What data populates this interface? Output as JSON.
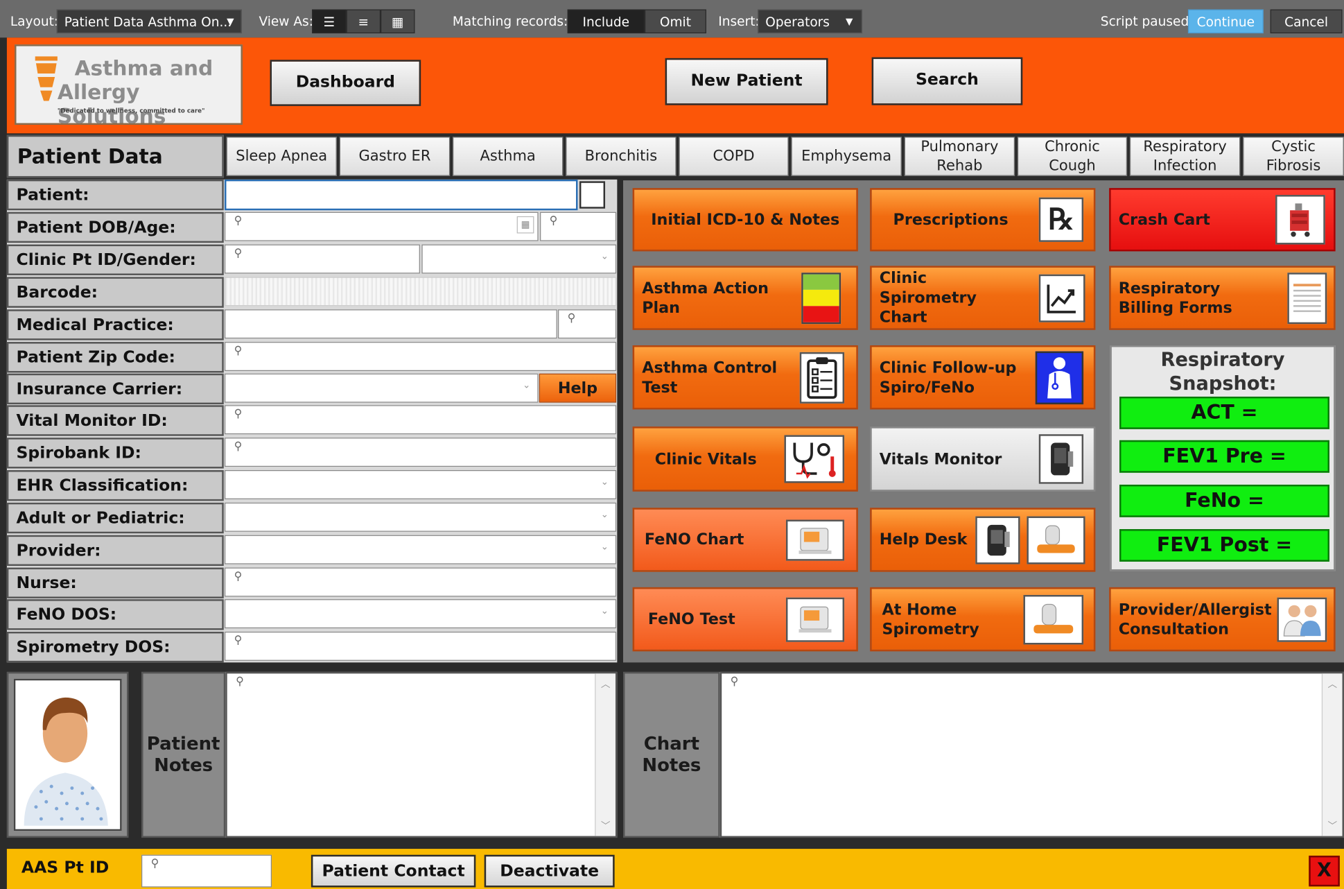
{
  "toolbar": {
    "layout_label": "Layout:",
    "layout_value": "Patient Data Asthma On...",
    "view_as_label": "View As:",
    "matching_label": "Matching records:",
    "include_label": "Include",
    "omit_label": "Omit",
    "insert_label": "Insert:",
    "insert_value": "Operators",
    "script_status": "Script paused",
    "continue_label": "Continue",
    "cancel_label": "Cancel"
  },
  "header": {
    "logo_line1": "Asthma and",
    "logo_line2": "Allergy Solutions",
    "logo_tagline": "\"Dedicated to wellness, committed to care\"",
    "dashboard_label": "Dashboard",
    "new_patient_label": "New Patient",
    "search_label": "Search"
  },
  "patient_data_title": "Patient Data",
  "tabs": [
    "Sleep Apnea",
    "Gastro ER",
    "Asthma",
    "Bronchitis",
    "COPD",
    "Emphysema",
    "Pulmonary Rehab",
    "Chronic Cough",
    "Respiratory Infection",
    "Cystic Fibrosis"
  ],
  "fields": {
    "patient": "Patient:",
    "dob": "Patient DOB/Age:",
    "clinic_id": "Clinic Pt ID/Gender:",
    "barcode": "Barcode:",
    "medical_practice": "Medical Practice:",
    "zip": "Patient Zip Code:",
    "insurance": "Insurance Carrier:",
    "vital_monitor": "Vital Monitor ID:",
    "spirobank": "Spirobank ID:",
    "ehr": "EHR Classification:",
    "adult_ped": "Adult or Pediatric:",
    "provider": "Provider:",
    "nurse": "Nurse:",
    "feno_dos": "FeNO DOS:",
    "spiro_dos": "Spirometry DOS:",
    "help_label": "Help"
  },
  "buttons": {
    "icd": "Initial ICD-10 & Notes",
    "prescriptions": "Prescriptions",
    "crash_cart": "Crash Cart",
    "action_plan": "Asthma Action Plan",
    "spiro_chart": "Clinic Spirometry Chart",
    "billing": "Respiratory Billing Forms",
    "act_test": "Asthma Control Test",
    "followup": "Clinic Follow-up Spiro/FeNo",
    "clinic_vitals": "Clinic Vitals",
    "vitals_monitor": "Vitals Monitor",
    "feno_chart": "FeNO Chart",
    "help_desk": "Help Desk",
    "feno_test": "FeNO Test",
    "home_spiro": "At Home Spirometry",
    "consult": "Provider/Allergist Consultation"
  },
  "snapshot": {
    "title": "Respiratory Snapshot:",
    "act": "ACT =",
    "fev1_pre": "FEV1 Pre =",
    "feno": "FeNo =",
    "fev1_post": "FEV1 Post ="
  },
  "notes": {
    "patient_notes": "Patient Notes",
    "chart_notes": "Chart Notes"
  },
  "footer": {
    "aas_id_label": "AAS Pt ID",
    "patient_contact": "Patient Contact",
    "deactivate": "Deactivate",
    "close": "X"
  },
  "colors": {
    "header_orange": "#fc5608",
    "footer_yellow": "#f9ba00",
    "snapshot_green": "#10ee10",
    "crash_red": "#ff2a1f",
    "continue_blue": "#5bb4ea"
  }
}
